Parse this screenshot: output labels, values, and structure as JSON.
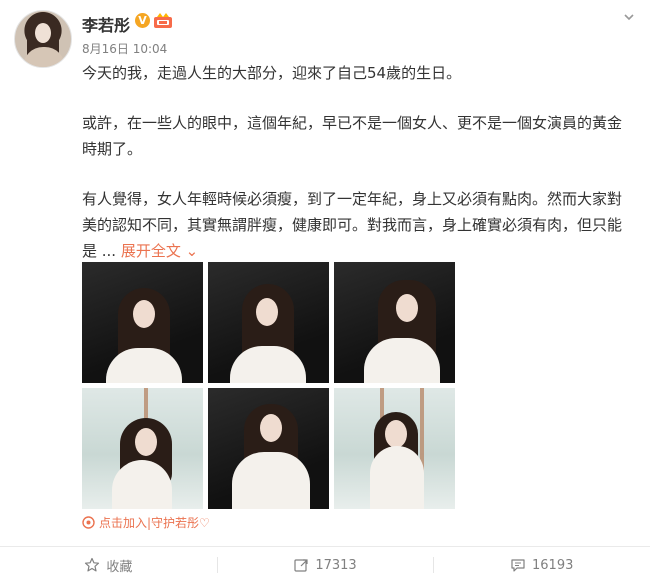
{
  "user": {
    "name": "李若彤",
    "vip_badge": "V",
    "time": "8月16日 10:04"
  },
  "post": {
    "paragraphs": [
      "今天的我，走過人生的大部分，迎來了自己54歲的生日。",
      "或許，在一些人的眼中，這個年紀，早已不是一個女人、更不是一個女演員的黃金時期了。",
      "有人覺得，女人年輕時候必須瘦，到了一定年紀，身上又必須有點肉。然而大家對美的認知不同，其實無謂胖瘦，健康即可。對我而言，身上確實必須有肉，但只能是 ..."
    ],
    "expand_label": "展开全文 ⌄"
  },
  "topic": {
    "label": "点击加入|守护若彤♡"
  },
  "actions": {
    "favorite_label": "收藏",
    "repost_count": "17313",
    "comment_count": "16193"
  },
  "colors": {
    "link": "#eb7350",
    "vip": "#f5a623",
    "text": "#333333",
    "muted": "#808080"
  }
}
